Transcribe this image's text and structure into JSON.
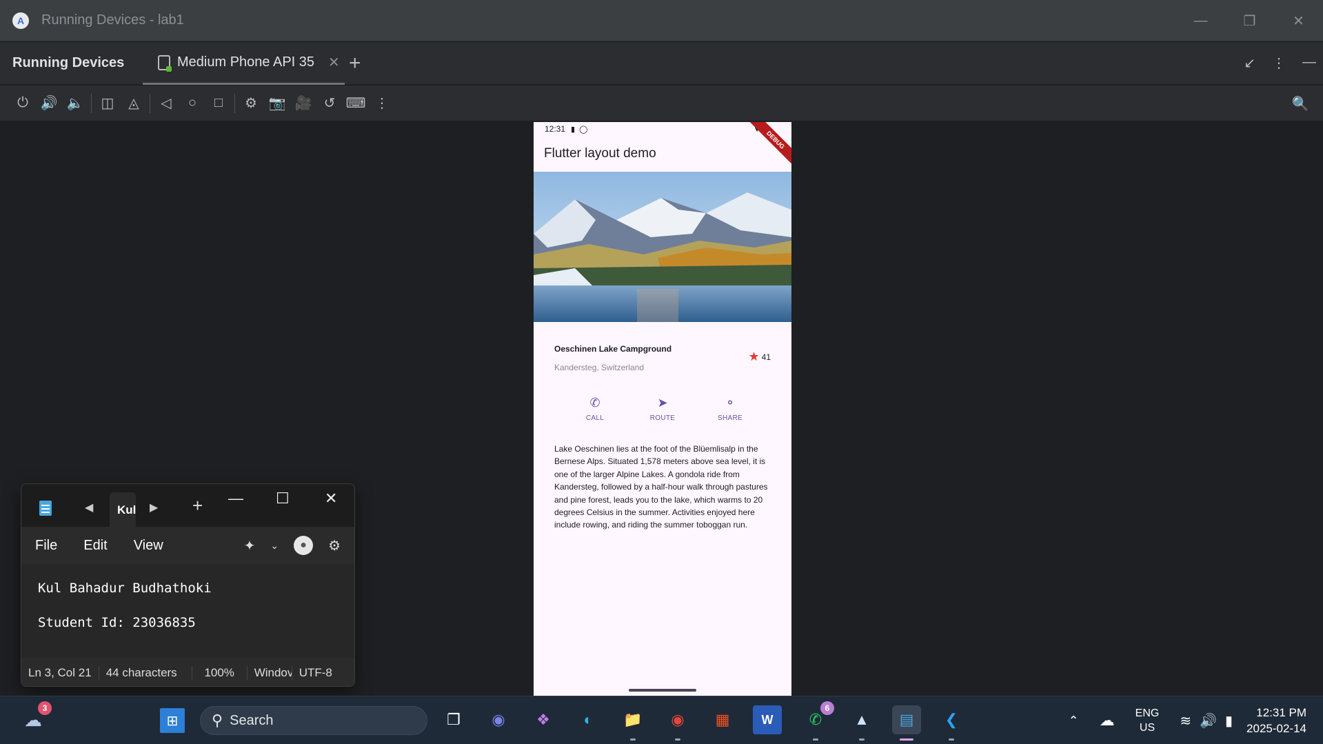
{
  "window": {
    "title": "Running Devices - lab1"
  },
  "toolwindow": {
    "title": "Running Devices",
    "tab_label": "Medium Phone API 35"
  },
  "phone": {
    "status_time": "12:31",
    "debug_banner": "DEBUG",
    "app_title": "Flutter layout demo",
    "place_name": "Oeschinen Lake Campground",
    "place_location": "Kandersteg, Switzerland",
    "star_count": "41",
    "actions": [
      {
        "label": "CALL",
        "icon": "phone-icon"
      },
      {
        "label": "ROUTE",
        "icon": "navigation-icon"
      },
      {
        "label": "SHARE",
        "icon": "share-icon"
      }
    ],
    "description": "Lake Oeschinen lies at the foot of the Blüemlisalp in the Bernese Alps. Situated 1,578 meters above sea level, it is one of the larger Alpine Lakes. A gondola ride from Kandersteg, followed by a half-hour walk through pastures and pine forest, leads you to the lake, which warms to 20 degrees Celsius in the summer. Activities enjoyed here include rowing, and riding the summer toboggan run."
  },
  "notepad": {
    "tab_label": "Kul",
    "menu": {
      "file": "File",
      "edit": "Edit",
      "view": "View"
    },
    "lines": [
      "Kul Bahadur Budhathoki",
      "Student Id: 23036835"
    ],
    "status": {
      "position": "Ln 3, Col 21",
      "chars": "44 characters",
      "zoom": "100%",
      "eol": "Windov",
      "encoding": "UTF-8"
    }
  },
  "taskbar": {
    "search_label": "Search",
    "weather_badge": "3",
    "whatsapp_badge": "6",
    "lang_line1": "ENG",
    "lang_line2": "US",
    "time": "12:31 PM",
    "date": "2025-02-14"
  },
  "colors": {
    "accent": "#6750a4",
    "star": "#e53935",
    "debug": "#b71c1c"
  }
}
